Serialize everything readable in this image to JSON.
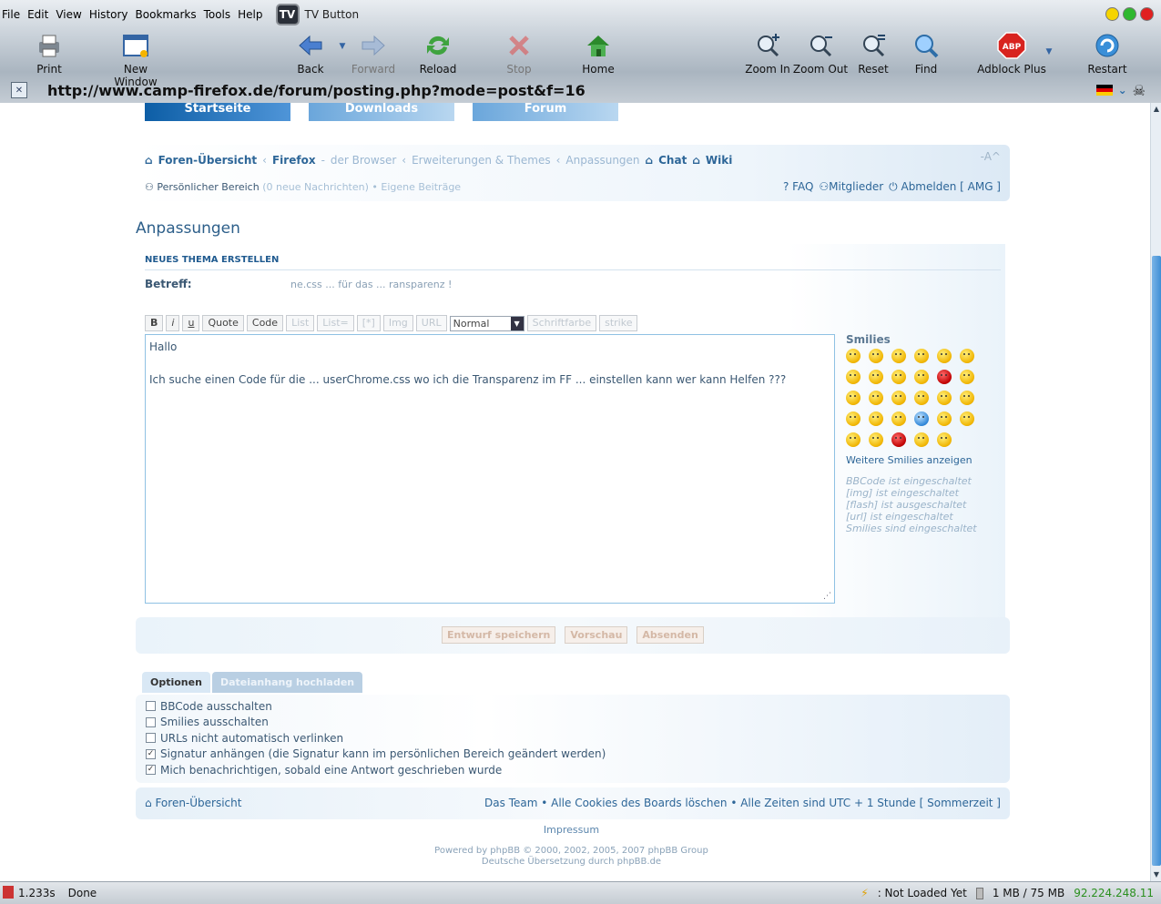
{
  "browser": {
    "menu": [
      "File",
      "Edit",
      "View",
      "History",
      "Bookmarks",
      "Tools",
      "Help"
    ],
    "tv_button": "TV Button",
    "tv_icon_text": "TV",
    "toolbar": {
      "print": "Print",
      "new_window": "New Window",
      "back": "Back",
      "forward": "Forward",
      "reload": "Reload",
      "stop": "Stop",
      "home": "Home",
      "zoom_in": "Zoom In",
      "zoom_out": "Zoom Out",
      "reset": "Reset",
      "find": "Find",
      "adblock": "Adblock Plus",
      "adblock_icon": "ABP",
      "restart": "Restart"
    },
    "url": "http://www.camp-firefox.de/forum/posting.php?mode=post&f=16"
  },
  "site": {
    "navtabs": [
      "Startseite",
      "Downloads",
      "Forum"
    ],
    "font_size_ctrl": "-A^",
    "crumbs": [
      "Foren-Übersicht",
      "Firefox",
      "der Browser",
      "Erweiterungen & Themes",
      "Anpassungen",
      "Chat",
      "Wiki"
    ],
    "user_area": "Persönlicher Bereich",
    "user_area_rest": "(0 neue Nachrichten) • Eigene Beiträge",
    "user_links": {
      "faq": "FAQ",
      "members": "Mitglieder",
      "logout": "Abmelden [ AMG ]"
    },
    "forum_title": "Anpassungen"
  },
  "post": {
    "heading": "NEUES THEMA ERSTELLEN",
    "subject_label": "Betreff:",
    "subject_value": "ne.css ... für das ... ransparenz !",
    "bbcode_buttons": [
      "B",
      "i",
      "u",
      "Quote",
      "Code",
      "List",
      "List=",
      "[*]",
      "Img",
      "URL"
    ],
    "font_select": "Normal",
    "font_color": "Schriftfarbe",
    "strike": "strike",
    "message_line1": "Hallo",
    "message_line2": "Ich suche einen Code für die ... userChrome.css wo ich die Transparenz im FF ... einstellen kann wer kann Helfen ???",
    "smilies_title": "Smilies",
    "smilies_more": "Weitere Smilies anzeigen",
    "status_lines": [
      "BBCode ist eingeschaltet",
      "[img] ist eingeschaltet",
      "[flash] ist ausgeschaltet",
      "[url] ist eingeschaltet",
      "Smilies sind eingeschaltet"
    ],
    "actions": {
      "draft": "Entwurf speichern",
      "preview": "Vorschau",
      "submit": "Absenden"
    }
  },
  "options": {
    "tabs": [
      "Optionen",
      "Dateianhang hochladen"
    ],
    "items": [
      {
        "label": "BBCode ausschalten",
        "checked": false
      },
      {
        "label": "Smilies ausschalten",
        "checked": false
      },
      {
        "label": "URLs nicht automatisch verlinken",
        "checked": false
      },
      {
        "label": "Signatur anhängen (die Signatur kann im persönlichen Bereich geändert werden)",
        "checked": true
      },
      {
        "label": "Mich benachrichtigen, sobald eine Antwort geschrieben wurde",
        "checked": true
      }
    ]
  },
  "footer": {
    "home": "Foren-Übersicht",
    "right": "Das Team • Alle Cookies des Boards löschen • Alle Zeiten sind UTC + 1 Stunde [ Sommerzeit ]",
    "impressum": "Impressum",
    "powered_line1": "Powered by phpBB © 2000, 2002, 2005, 2007 phpBB Group",
    "powered_line2": "Deutsche Übersetzung durch phpBB.de"
  },
  "status": {
    "time": "1.233s",
    "text": "Done",
    "not_loaded": ": Not Loaded Yet",
    "memory": "1 MB / 75 MB",
    "ip": "92.224.248.11"
  },
  "colors": {
    "link": "#2d6698",
    "accent": "#3f8fd6",
    "ip_green": "#2a8f1e"
  }
}
